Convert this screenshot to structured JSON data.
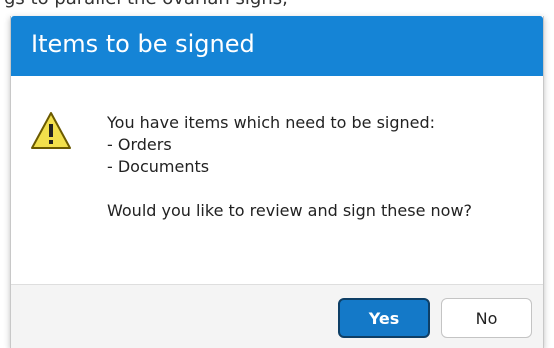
{
  "backdrop": {
    "partial_text": "gs to parallel the ovarian signs, "
  },
  "dialog": {
    "title": "Items to be signed",
    "icon": "warning-icon",
    "message_lines": [
      "You have items which need to be signed:",
      "- Orders",
      "- Documents"
    ],
    "question": "Would you like to review and sign these now?",
    "buttons": {
      "yes_label": "Yes",
      "no_label": "No"
    }
  },
  "colors": {
    "titlebar": "#1584d6",
    "primary_button": "#1479c8",
    "primary_button_border": "#0e3f66",
    "warning_fill": "#f2e04c",
    "warning_stroke": "#6b5a00"
  }
}
